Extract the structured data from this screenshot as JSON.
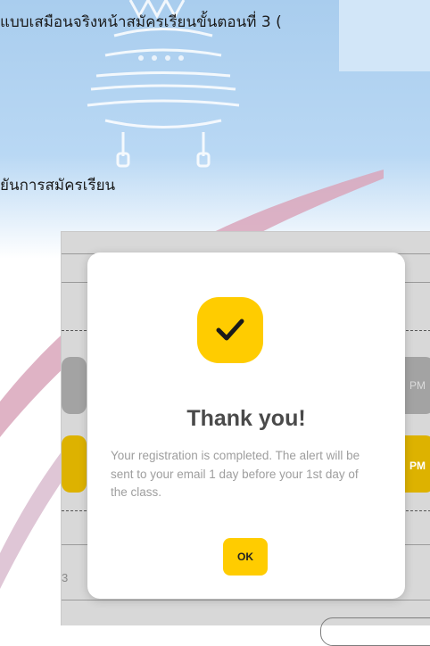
{
  "document": {
    "line1": "แบบเสมือนจริงหน้าสมัครเรียนขั้นตอนที่ 3 (",
    "line2": "ยันการสมัครเรียน"
  },
  "background": {
    "side_left_top_text": "",
    "side_right_top_text": "PM",
    "side_right_mid_text": "PM",
    "side_left_bottom_text": "3"
  },
  "modal": {
    "icon": "checkmark-icon",
    "title": "Thank you!",
    "message": "Your registration is completed. The alert will be sent to your email 1 day before your 1st day of the class.",
    "ok_label": "OK"
  },
  "colors": {
    "accent": "#ffcc00",
    "title": "#4a4a4a",
    "message": "#9e9e9e"
  }
}
